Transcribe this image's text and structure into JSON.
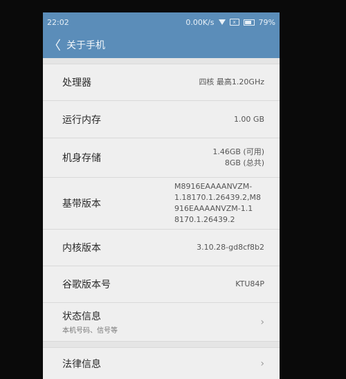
{
  "status": {
    "time": "22:02",
    "network_speed": "0.00K/s",
    "battery": "79%"
  },
  "appbar": {
    "back_glyph": "〈",
    "title": "关于手机"
  },
  "rows": {
    "cpu": {
      "label": "处理器",
      "value": "四核 最高1.20GHz"
    },
    "ram": {
      "label": "运行内存",
      "value": "1.00 GB"
    },
    "storage": {
      "label": "机身存储",
      "value_line1": "1.46GB (可用)",
      "value_line2": "8GB (总共)"
    },
    "baseband": {
      "label": "基带版本",
      "value_line1": "M8916EAAAANVZM-",
      "value_line2": "1.18170.1.26439.2,M8",
      "value_line3": "916EAAAANVZM-1.1",
      "value_line4": "8170.1.26439.2"
    },
    "kernel": {
      "label": "内核版本",
      "value": "3.10.28-gd8cf8b2"
    },
    "build": {
      "label": "谷歌版本号",
      "value": "KTU84P"
    },
    "status_info": {
      "label": "状态信息",
      "sublabel": "本机号码、信号等"
    },
    "legal": {
      "label": "法律信息"
    }
  },
  "colors": {
    "accent": "#5b8db9",
    "background": "#efefef"
  }
}
